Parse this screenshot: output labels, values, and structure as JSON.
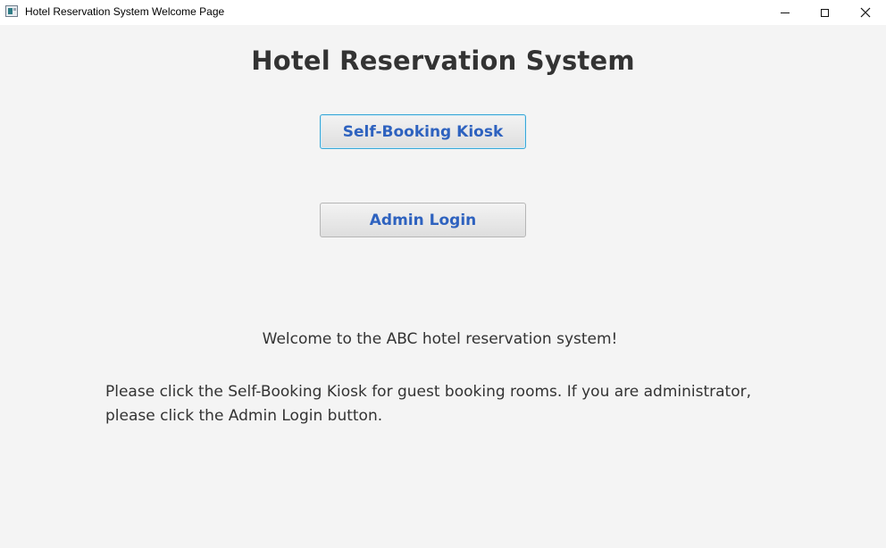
{
  "window": {
    "title": "Hotel Reservation System Welcome Page",
    "icons": {
      "app": "app-window-icon",
      "minimize": "minimize-icon",
      "maximize": "maximize-icon",
      "close": "close-icon"
    },
    "close_glyph": "✕"
  },
  "main": {
    "heading": "Hotel Reservation System",
    "kiosk_button_label": "Self-Booking Kiosk",
    "admin_button_label": "Admin Login",
    "welcome_text": "Welcome to the ABC hotel reservation system!",
    "instructions_text": "Please click the Self-Booking Kiosk for guest booking rooms. If you are administrator, please click the Admin Login button."
  },
  "colors": {
    "background": "#f4f4f4",
    "button_text": "#2e62bf",
    "text": "#333333",
    "focus_border": "#3aa7d6"
  }
}
